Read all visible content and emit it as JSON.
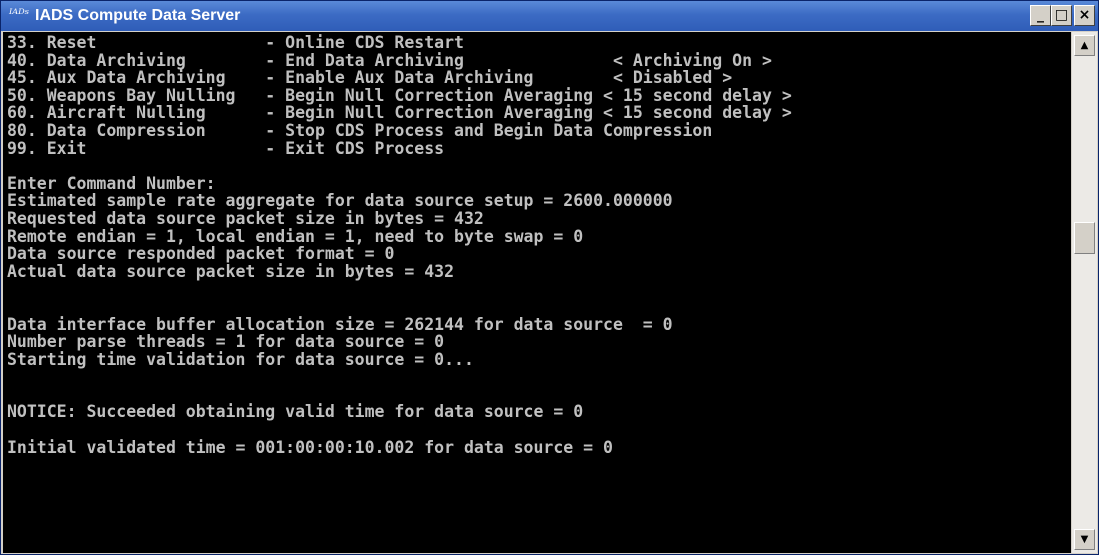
{
  "window": {
    "icon": "iads-app-icon",
    "icon_glyph": "ᴵᴬᴰˢ",
    "title": "IADS Compute Data Server",
    "minimize_label": "_",
    "maximize_label": "□",
    "close_label": "×"
  },
  "console": {
    "lines": [
      "33. Reset                 - Online CDS Restart",
      "40. Data Archiving        - End Data Archiving               < Archiving On >",
      "45. Aux Data Archiving    - Enable Aux Data Archiving        < Disabled >",
      "50. Weapons Bay Nulling   - Begin Null Correction Averaging < 15 second delay >",
      "60. Aircraft Nulling      - Begin Null Correction Averaging < 15 second delay >",
      "80. Data Compression      - Stop CDS Process and Begin Data Compression",
      "99. Exit                  - Exit CDS Process",
      "",
      "Enter Command Number:",
      "Estimated sample rate aggregate for data source setup = 2600.000000",
      "Requested data source packet size in bytes = 432",
      "Remote endian = 1, local endian = 1, need to byte swap = 0",
      "Data source responded packet format = 0",
      "Actual data source packet size in bytes = 432",
      "",
      "",
      "Data interface buffer allocation size = 262144 for data source  = 0",
      "Number parse threads = 1 for data source = 0",
      "Starting time validation for data source = 0...",
      "",
      "",
      "NOTICE: Succeeded obtaining valid time for data source = 0",
      "",
      "Initial validated time = 001:00:00:10.002 for data source = 0"
    ]
  },
  "scrollbar": {
    "up_icon": "scroll-up-arrow-icon",
    "down_icon": "scroll-down-arrow-icon",
    "up_glyph": "▲",
    "down_glyph": "▼"
  }
}
